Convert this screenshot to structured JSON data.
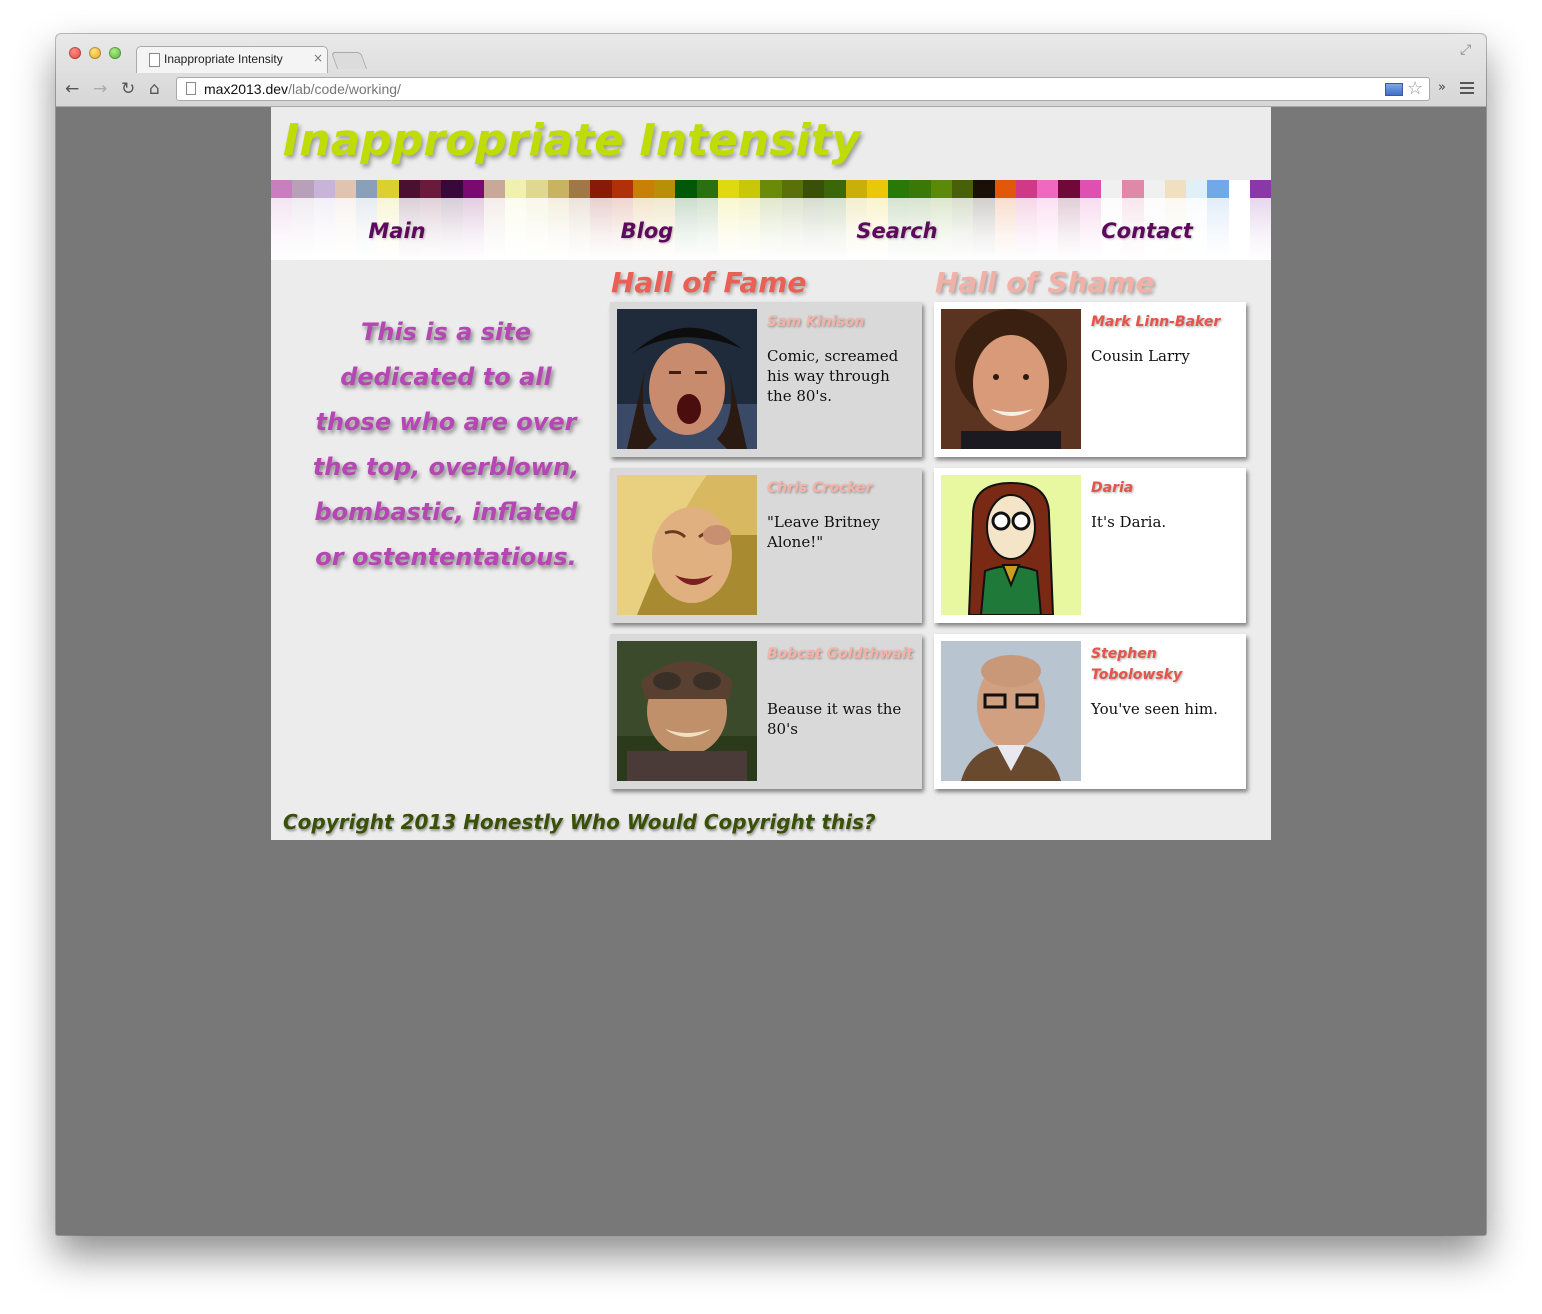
{
  "browser": {
    "tab_title": "Inappropriate Intensity",
    "tab_close": "×",
    "url_host": "max2013.dev",
    "url_path": "/lab/code/working/",
    "back_icon": "arrow-left-icon",
    "forward_icon": "arrow-right-icon",
    "reload_icon": "reload-icon",
    "home_icon": "home-icon",
    "star_icon": "star-icon",
    "overflow_label": "»"
  },
  "site": {
    "title": "Inappropriate Intensity",
    "title_color": "#bfdc06",
    "nav": [
      "Main",
      "Blog",
      "Search",
      "Contact"
    ],
    "tagline": "This is a site dedicated to all those who are over the top, overblown, bombastic, inflated or ostententatious.",
    "hall_of_fame": {
      "heading": "Hall of Fame",
      "entries": [
        {
          "name": "Sam Kinison",
          "desc": "Comic, screamed his way through the 80's."
        },
        {
          "name": "Chris Crocker",
          "desc": "\"Leave Britney Alone!\""
        },
        {
          "name": "Bobcat Goldthwait",
          "desc": "Beause it was the 80's"
        }
      ]
    },
    "hall_of_shame": {
      "heading": "Hall of Shame",
      "entries": [
        {
          "name": "Mark Linn-Baker",
          "desc": "Cousin Larry"
        },
        {
          "name": "Daria",
          "desc": "It's Daria."
        },
        {
          "name": "Stephen Tobolowsky",
          "desc": "You've seen him."
        }
      ]
    },
    "footer": "Copyright 2013 Honestly Who Would Copyright this?",
    "stripe_colors": [
      "#c87fc0",
      "#b8a0b8",
      "#c8b4d8",
      "#e0c4b0",
      "#8aa0b8",
      "#dcd030",
      "#4a1030",
      "#6a1a3a",
      "#380838",
      "#7a0a70",
      "#c8a898",
      "#f0f0b0",
      "#e0d890",
      "#c8b460",
      "#a07848",
      "#8a1a08",
      "#b03008",
      "#c88008",
      "#b89008",
      "#005808",
      "#2a7010",
      "#e0d810",
      "#c8c808",
      "#6a8a08",
      "#5a7008",
      "#3a5008",
      "#3a6808",
      "#c8b008",
      "#e8c808",
      "#2a7808",
      "#3a7808",
      "#5a8a08",
      "#486008",
      "#1a1008",
      "#e05808",
      "#d03888",
      "#f068c0",
      "#700838",
      "#e050b0",
      "#f0f0f0",
      "#e088a8",
      "#f0f0f0",
      "#f0e0c0",
      "#e0f0f8",
      "#70a8e8",
      "#ffffff",
      "#8a38a8"
    ]
  }
}
